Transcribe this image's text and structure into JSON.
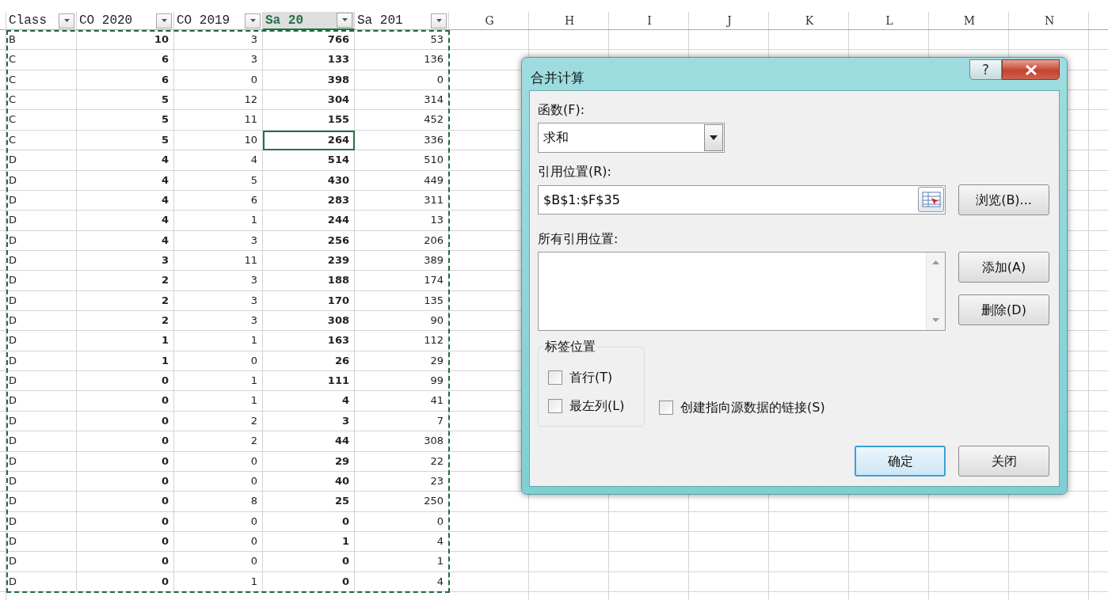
{
  "sheet": {
    "columns": [
      {
        "kind": "field",
        "label": "Class",
        "filter": true,
        "selected": false,
        "bold": false
      },
      {
        "kind": "field",
        "label": "CO 2020",
        "filter": true,
        "selected": false,
        "bold": true
      },
      {
        "kind": "field",
        "label": "CO 2019",
        "filter": true,
        "selected": false,
        "bold": false
      },
      {
        "kind": "field",
        "label": "Sa 20",
        "filter": true,
        "selected": true,
        "bold": true
      },
      {
        "kind": "field",
        "label": "Sa 201",
        "filter": true,
        "selected": false,
        "bold": false
      },
      {
        "kind": "letter",
        "label": "G"
      },
      {
        "kind": "letter",
        "label": "H"
      },
      {
        "kind": "letter",
        "label": "I"
      },
      {
        "kind": "letter",
        "label": "J"
      },
      {
        "kind": "letter",
        "label": "K"
      },
      {
        "kind": "letter",
        "label": "L"
      },
      {
        "kind": "letter",
        "label": "M"
      },
      {
        "kind": "letter",
        "label": "N"
      }
    ],
    "rows": [
      {
        "cells": [
          "B",
          "10",
          "3",
          "766",
          "53"
        ],
        "active": false
      },
      {
        "cells": [
          "C",
          "6",
          "3",
          "133",
          "136"
        ],
        "active": false
      },
      {
        "cells": [
          "C",
          "6",
          "0",
          "398",
          "0"
        ],
        "active": false
      },
      {
        "cells": [
          "C",
          "5",
          "12",
          "304",
          "314"
        ],
        "active": false
      },
      {
        "cells": [
          "C",
          "5",
          "11",
          "155",
          "452"
        ],
        "active": false
      },
      {
        "cells": [
          "C",
          "5",
          "10",
          "264",
          "336"
        ],
        "active": true
      },
      {
        "cells": [
          "D",
          "4",
          "4",
          "514",
          "510"
        ],
        "active": false
      },
      {
        "cells": [
          "D",
          "4",
          "5",
          "430",
          "449"
        ],
        "active": false
      },
      {
        "cells": [
          "D",
          "4",
          "6",
          "283",
          "311"
        ],
        "active": false
      },
      {
        "cells": [
          "D",
          "4",
          "1",
          "244",
          "13"
        ],
        "active": false
      },
      {
        "cells": [
          "D",
          "4",
          "3",
          "256",
          "206"
        ],
        "active": false
      },
      {
        "cells": [
          "D",
          "3",
          "11",
          "239",
          "389"
        ],
        "active": false
      },
      {
        "cells": [
          "D",
          "2",
          "3",
          "188",
          "174"
        ],
        "active": false
      },
      {
        "cells": [
          "D",
          "2",
          "3",
          "170",
          "135"
        ],
        "active": false
      },
      {
        "cells": [
          "D",
          "2",
          "3",
          "308",
          "90"
        ],
        "active": false
      },
      {
        "cells": [
          "D",
          "1",
          "1",
          "163",
          "112"
        ],
        "active": false
      },
      {
        "cells": [
          "D",
          "1",
          "0",
          "26",
          "29"
        ],
        "active": false
      },
      {
        "cells": [
          "D",
          "0",
          "1",
          "111",
          "99"
        ],
        "active": false
      },
      {
        "cells": [
          "D",
          "0",
          "1",
          "4",
          "41"
        ],
        "active": false
      },
      {
        "cells": [
          "D",
          "0",
          "2",
          "3",
          "7"
        ],
        "active": false
      },
      {
        "cells": [
          "D",
          "0",
          "2",
          "44",
          "308"
        ],
        "active": false
      },
      {
        "cells": [
          "D",
          "0",
          "0",
          "29",
          "22"
        ],
        "active": false
      },
      {
        "cells": [
          "D",
          "0",
          "0",
          "40",
          "23"
        ],
        "active": false
      },
      {
        "cells": [
          "D",
          "0",
          "8",
          "25",
          "250"
        ],
        "active": false
      },
      {
        "cells": [
          "D",
          "0",
          "0",
          "0",
          "0"
        ],
        "active": false
      },
      {
        "cells": [
          "D",
          "0",
          "0",
          "1",
          "4"
        ],
        "active": false
      },
      {
        "cells": [
          "D",
          "0",
          "0",
          "0",
          "1"
        ],
        "active": false
      },
      {
        "cells": [
          "D",
          "0",
          "1",
          "0",
          "4"
        ],
        "active": false
      }
    ]
  },
  "dialog": {
    "title": "合并计算",
    "help_button": "?",
    "function_label": "函数(F):",
    "function_value": "求和",
    "reference_label": "引用位置(R):",
    "reference_value": "$B$1:$F$35",
    "browse_button": "浏览(B)...",
    "all_references_label": "所有引用位置:",
    "add_button": "添加(A)",
    "delete_button": "删除(D)",
    "label_group": {
      "title": "标签位置",
      "options": [
        {
          "label": "首行(T)",
          "checked": false
        },
        {
          "label": "最左列(L)",
          "checked": false
        }
      ]
    },
    "link_option": {
      "label": "创建指向源数据的链接(S)",
      "checked": false
    },
    "ok_button": "确定",
    "close_button": "关闭"
  }
}
